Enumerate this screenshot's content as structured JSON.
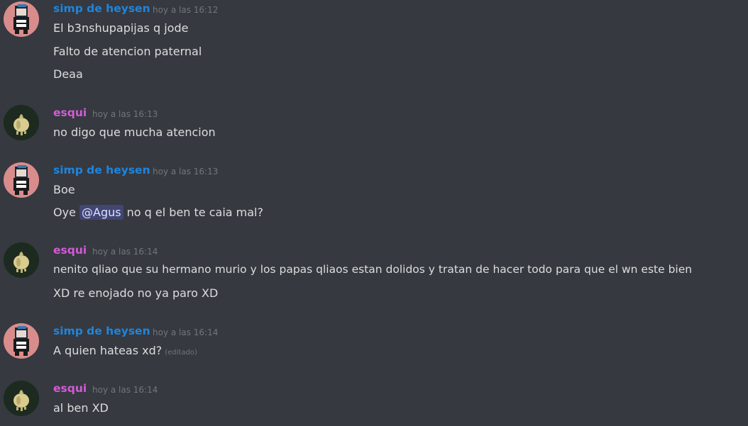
{
  "colors": {
    "background": "#36393f",
    "text": "#dcddde",
    "timestamp": "#72767d",
    "simp_name": "#1f85de",
    "esqui_name": "#d35bd8",
    "mention_bg": "#414675"
  },
  "groups": [
    {
      "author": "simp de heysen",
      "time": "hoy a las 16:12",
      "avatar_icon": "pixel-character-avatar-icon",
      "messages": [
        "El b3nshupapijas q jode",
        "Falto de atencion paternal",
        "Deaa"
      ]
    },
    {
      "author": "esqui",
      "time": "hoy a las 16:13",
      "avatar_icon": "garlic-avatar-icon",
      "messages": [
        "no digo que mucha atencion"
      ]
    },
    {
      "author": "simp de heysen",
      "time": "hoy a las 16:13",
      "avatar_icon": "pixel-character-avatar-icon",
      "messages": [
        "Boe"
      ],
      "mention_message": {
        "before": "Oye ",
        "mention": "@Agus",
        "after": " no q el ben te caia mal?"
      }
    },
    {
      "author": "esqui",
      "time": "hoy a las 16:14",
      "avatar_icon": "garlic-avatar-icon",
      "messages": [
        "nenito qliao que su hermano murio y los papas qliaos estan dolidos y tratan de hacer todo para que el wn este bien",
        "XD re enojado no ya paro XD"
      ]
    },
    {
      "author": "simp de heysen",
      "time": "hoy a las 16:14",
      "avatar_icon": "pixel-character-avatar-icon",
      "messages": [
        "A quien hateas xd?"
      ],
      "edited_label": "(editado)"
    },
    {
      "author": "esqui",
      "time": "hoy a las 16:14",
      "avatar_icon": "garlic-avatar-icon",
      "messages": [
        "al ben XD"
      ]
    }
  ]
}
